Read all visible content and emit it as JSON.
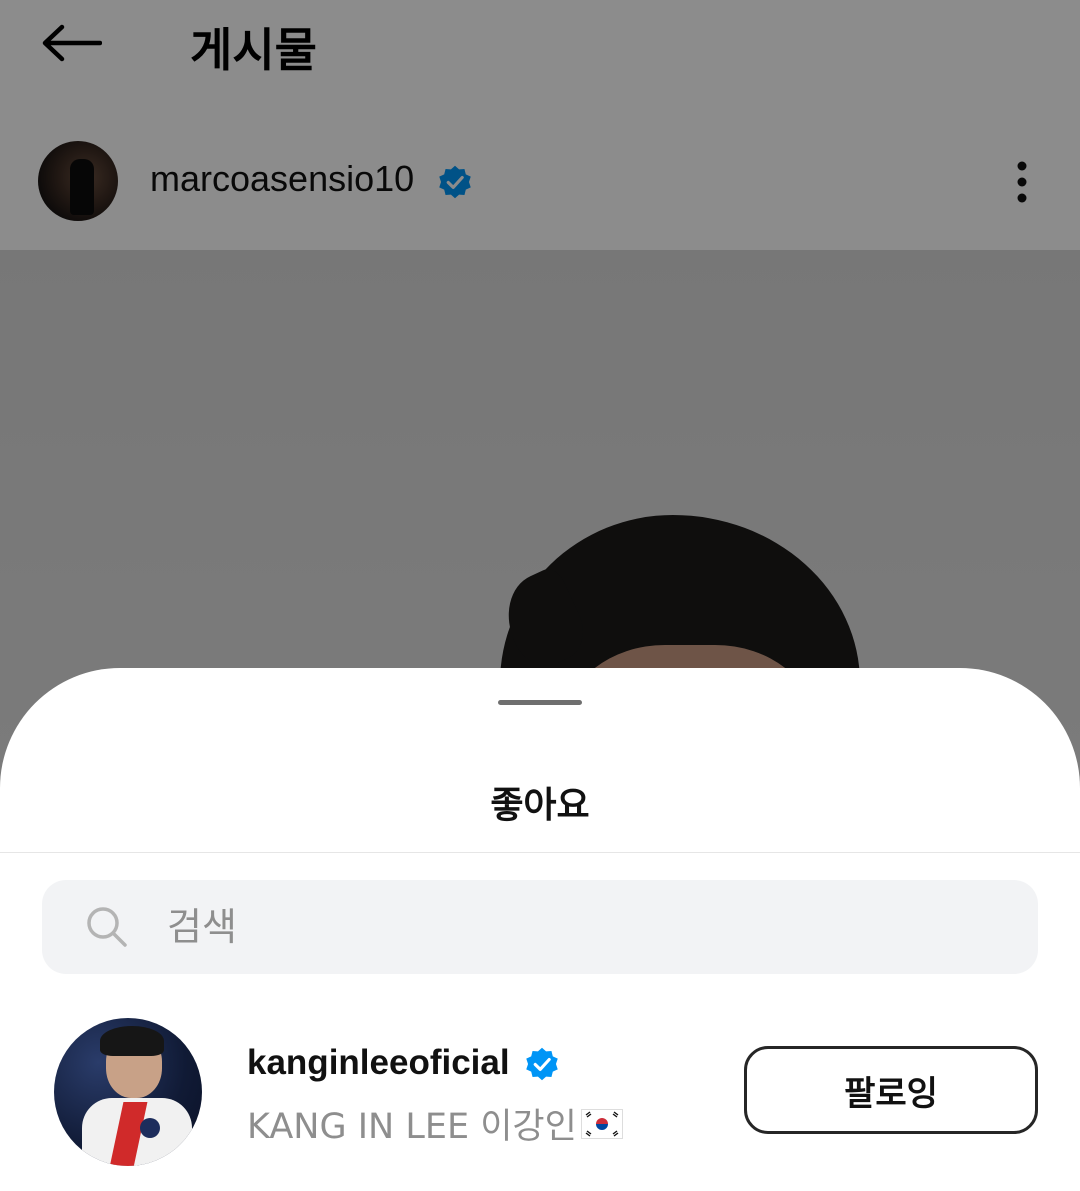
{
  "header": {
    "title": "게시물",
    "back_icon": "arrow-left-icon"
  },
  "post": {
    "author_username": "marcoasensio10",
    "author_verified": true,
    "more_icon": "more-vertical-icon"
  },
  "likes_sheet": {
    "title": "좋아요",
    "search": {
      "placeholder": "검색",
      "value": "",
      "icon": "search-icon"
    },
    "users": [
      {
        "username": "kanginleeoficial",
        "verified": true,
        "full_name": "KANG IN LEE 이강인",
        "flag_icon": "south-korea-flag-icon",
        "follow_label": "팔로잉"
      }
    ]
  },
  "colors": {
    "verified_blue": "#0095f6",
    "dim_overlay": "rgba(0,0,0,0.45)",
    "secondary_text": "#8e8e8e",
    "search_bg": "#f2f3f5"
  }
}
